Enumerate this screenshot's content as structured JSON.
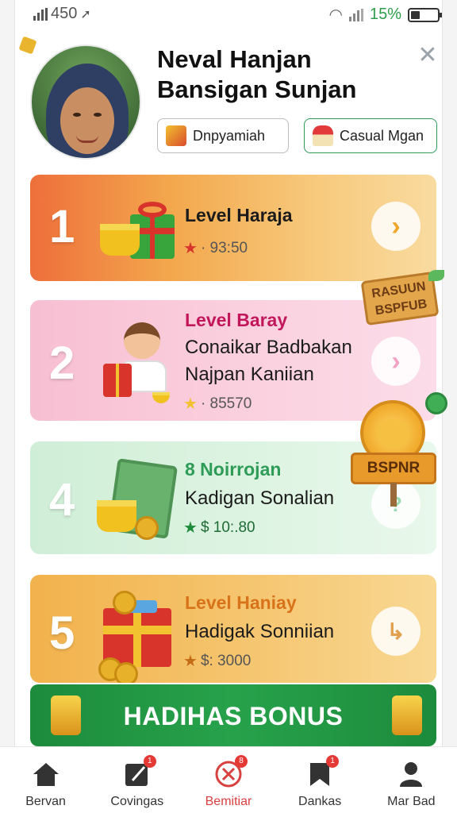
{
  "status_bar": {
    "signal_label": "450",
    "battery_percent": "15%"
  },
  "profile": {
    "name_line1": "Neval Hanjan",
    "name_line2": "Bansigan Sunjan",
    "tag1_label": "Dnpyamiah",
    "tag2_label": "Casual Mgan"
  },
  "levels": [
    {
      "rank": "1",
      "title": "Level Haraja",
      "line1": "",
      "line2": "",
      "meta": "· 93:50"
    },
    {
      "rank": "2",
      "title": "Level Baray",
      "line1": "Conaikar Badbakan",
      "line2": "Najpan Kaniian",
      "meta": "· 85570"
    },
    {
      "rank": "4",
      "title": "8 Noirrojan",
      "line1": "Kadigan Sonalian",
      "line2": "",
      "meta": "$ 10:.80"
    },
    {
      "rank": "5",
      "title": "Level Haniay",
      "line1": "Hadigak Sonniian",
      "line2": "",
      "meta": "$: 3000"
    }
  ],
  "badges": {
    "rasuun": "RASUUN\nBSPFUB",
    "medal_ribbon": "BSPNR"
  },
  "bonus_label": "HADIHAS BONUS",
  "nav": [
    {
      "label": "Bervan",
      "icon": "home-icon"
    },
    {
      "label": "Covingas",
      "icon": "edit-icon",
      "badge": "1"
    },
    {
      "label": "Bemitiar",
      "icon": "close-circle-icon",
      "badge": "8"
    },
    {
      "label": "Dankas",
      "icon": "bookmark-icon",
      "badge": "1"
    },
    {
      "label": "Mar Bad",
      "icon": "user-icon"
    }
  ],
  "colors": {
    "accent_green": "#27a24b",
    "active_red": "#d94040",
    "card1": "#ee6f3b",
    "card2": "#fbd2e0",
    "card3": "#dff4e3",
    "card4": "#f5c46d"
  }
}
